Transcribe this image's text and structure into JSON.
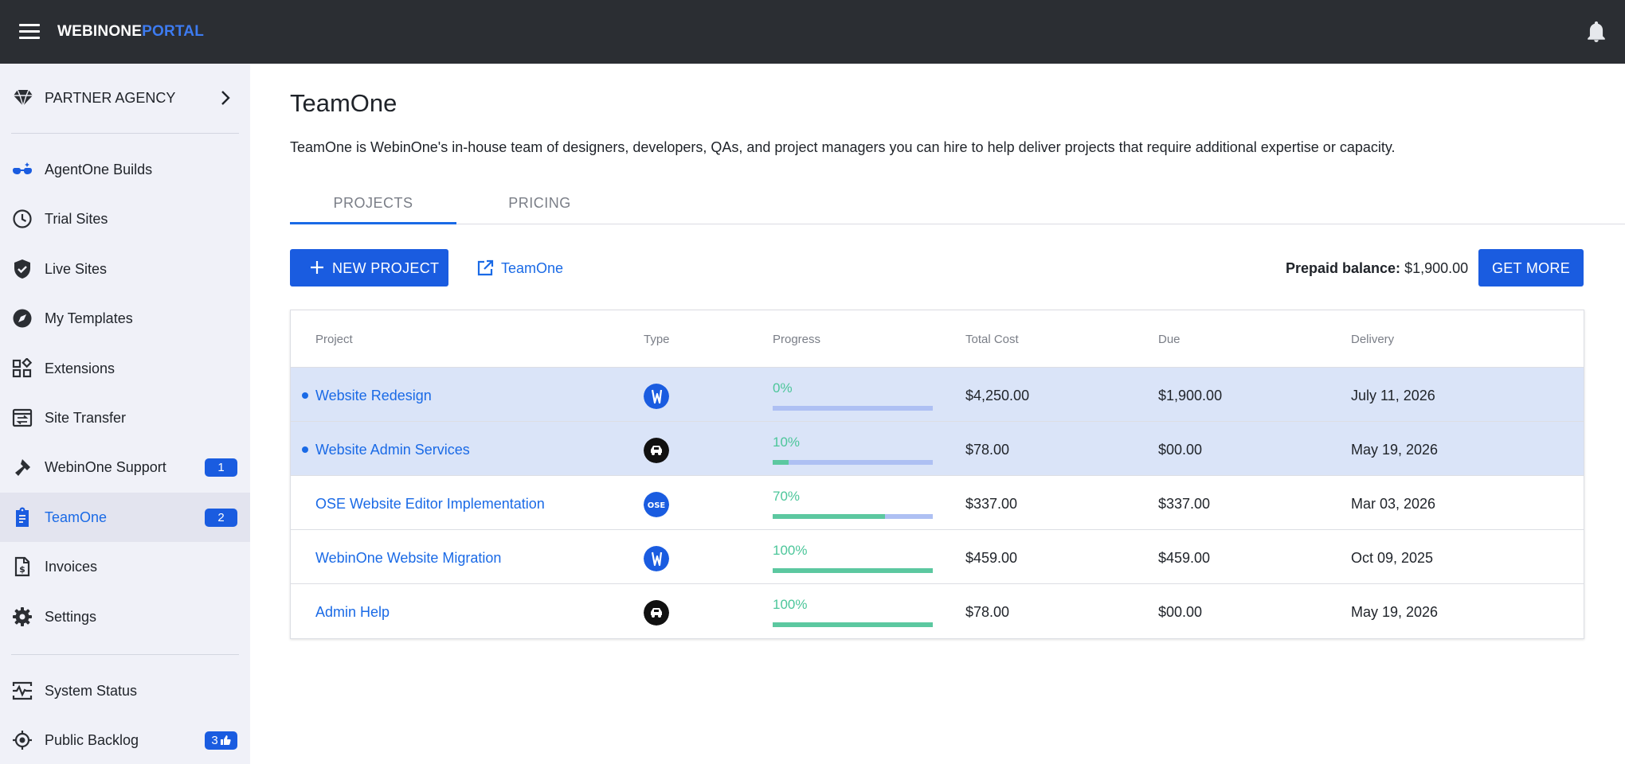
{
  "app": {
    "logo_part1": "WEBINONE",
    "logo_part2": "PORTAL",
    "icons": {
      "menu": "hamburger-menu-icon",
      "notifications": "bell-icon"
    }
  },
  "sidebar": {
    "partner": {
      "label": "PARTNER AGENCY",
      "icon": "diamond-icon"
    },
    "items": [
      {
        "label": "AgentOne Builds",
        "icon": "glasses-icon"
      },
      {
        "label": "Trial Sites",
        "icon": "clock-icon"
      },
      {
        "label": "Live Sites",
        "icon": "shield-check-icon"
      },
      {
        "label": "My Templates",
        "icon": "compass-icon"
      },
      {
        "label": "Extensions",
        "icon": "widgets-icon"
      },
      {
        "label": "Site Transfer",
        "icon": "transfer-icon"
      },
      {
        "label": "WebinOne Support",
        "icon": "wrench-icon",
        "badge": "1"
      },
      {
        "label": "TeamOne",
        "icon": "clipboard-icon",
        "badge": "2",
        "active": true
      },
      {
        "label": "Invoices",
        "icon": "invoice-icon"
      },
      {
        "label": "Settings",
        "icon": "gear-icon"
      },
      {
        "label": "System Status",
        "icon": "monitor-pulse-icon"
      },
      {
        "label": "Public Backlog",
        "icon": "target-icon",
        "badge": "3"
      }
    ]
  },
  "main": {
    "title": "TeamOne",
    "description": "TeamOne is WebinOne's in-house team of designers, developers, QAs, and project managers you can hire to help deliver projects that require additional expertise or capacity.",
    "tabs": [
      {
        "label": "PROJECTS",
        "active": true
      },
      {
        "label": "PRICING",
        "active": false
      }
    ],
    "new_project_label": "NEW PROJECT",
    "teamone_link_label": "TeamOne",
    "prepaid_label": "Prepaid balance:",
    "prepaid_value": "$1,900.00",
    "get_more_label": "GET MORE"
  },
  "table": {
    "headers": {
      "project": "Project",
      "type": "Type",
      "progress": "Progress",
      "total_cost": "Total Cost",
      "due": "Due",
      "delivery": "Delivery"
    },
    "rows": [
      {
        "project": "Website Redesign",
        "type_icon": "webinone-w-icon",
        "progress_label": "0%",
        "progress": 0,
        "total_cost": "$4,250.00",
        "due": "$1,900.00",
        "delivery": "July 11, 2026",
        "unread": true
      },
      {
        "project": "Website Admin Services",
        "type_icon": "admin-car-icon",
        "progress_label": "10%",
        "progress": 10,
        "total_cost": "$78.00",
        "due": "$00.00",
        "delivery": "May 19, 2026",
        "unread": true
      },
      {
        "project": "OSE Website Editor Implementation",
        "type_icon": "ose-icon",
        "type_text": "OSE",
        "progress_label": "70%",
        "progress": 70,
        "total_cost": "$337.00",
        "due": "$337.00",
        "delivery": "Mar 03, 2026",
        "unread": false
      },
      {
        "project": "WebinOne Website Migration",
        "type_icon": "webinone-w-icon",
        "progress_label": "100%",
        "progress": 100,
        "total_cost": "$459.00",
        "due": "$459.00",
        "delivery": "Oct 09, 2025",
        "unread": false
      },
      {
        "project": "Admin Help",
        "type_icon": "admin-car-icon",
        "progress_label": "100%",
        "progress": 100,
        "total_cost": "$78.00",
        "due": "$00.00",
        "delivery": "May 19, 2026",
        "unread": false
      }
    ]
  },
  "colors": {
    "topbar": "#2b2e33",
    "sidebar": "#f0f1f8",
    "accent": "#1a5ce0",
    "link": "#1a6ae6",
    "progress_fill": "#5cc8a0",
    "progress_track": "#aec0f3",
    "row_highlight": "#dae4f8"
  }
}
